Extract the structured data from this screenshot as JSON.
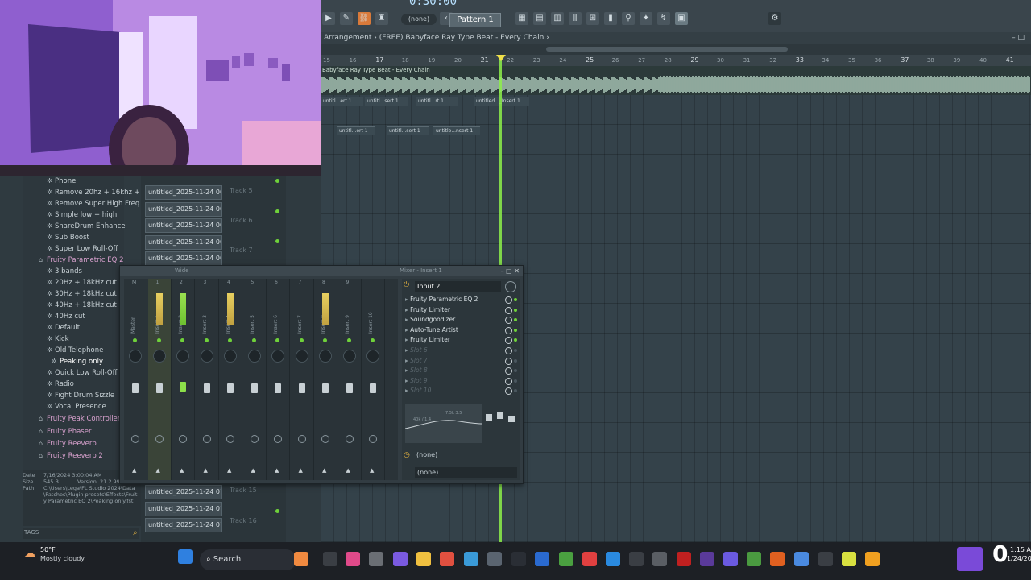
{
  "toolbar": {
    "time": "0:30:00",
    "none_selector": "(none)",
    "pattern": "Pattern 1"
  },
  "playlist": {
    "breadcrumb": "Arrangement › (FREE) Babyface Ray Type Beat - Every Chain ›",
    "audio_track_label": "Babyface Ray Type Beat - Every Chain",
    "timeline_ticks": [
      "15",
      "16",
      "17",
      "18",
      "19",
      "20",
      "21",
      "22",
      "23",
      "24",
      "25",
      "26",
      "27",
      "28",
      "29",
      "30",
      "31",
      "32",
      "33",
      "34",
      "35",
      "36",
      "37",
      "38",
      "39",
      "40",
      "41"
    ],
    "clips_row1": [
      "untitl...ert 1",
      "untitl...sert 1",
      "untitl...rt 1",
      "untitled..._Insert 1"
    ],
    "clips_row2": [
      "untitl...ert 1",
      "untitl...sert 1",
      "untitle...nsert 1"
    ]
  },
  "browser": {
    "items": [
      {
        "label": "Phone",
        "kind": "preset"
      },
      {
        "label": "Remove 20hz + 16khz +",
        "kind": "preset"
      },
      {
        "label": "Remove Super High Freq",
        "kind": "preset"
      },
      {
        "label": "Simple low + high",
        "kind": "preset"
      },
      {
        "label": "SnareDrum Enhance",
        "kind": "preset"
      },
      {
        "label": "Sub Boost",
        "kind": "preset"
      },
      {
        "label": "Super Low Roll-Off",
        "kind": "preset"
      },
      {
        "label": "Fruity Parametric EQ 2",
        "kind": "plugin"
      },
      {
        "label": "3 bands",
        "kind": "preset"
      },
      {
        "label": "20Hz + 18kHz cut",
        "kind": "preset"
      },
      {
        "label": "30Hz + 18kHz cut",
        "kind": "preset"
      },
      {
        "label": "40Hz + 18kHz cut",
        "kind": "preset"
      },
      {
        "label": "40Hz cut",
        "kind": "preset"
      },
      {
        "label": "Default",
        "kind": "preset"
      },
      {
        "label": "Kick",
        "kind": "preset"
      },
      {
        "label": "Old Telephone",
        "kind": "preset"
      },
      {
        "label": "Peaking only",
        "kind": "selected"
      },
      {
        "label": "Quick Low Roll-Off",
        "kind": "preset"
      },
      {
        "label": "Radio",
        "kind": "preset"
      },
      {
        "label": "Fight Drum Sizzle",
        "kind": "preset"
      },
      {
        "label": "Vocal Presence",
        "kind": "preset"
      },
      {
        "label": "Fruity Peak Controller",
        "kind": "plugin"
      },
      {
        "label": "Fruity Phaser",
        "kind": "plugin"
      },
      {
        "label": "Fruity Reeverb",
        "kind": "plugin"
      },
      {
        "label": "Fruity Reeverb 2",
        "kind": "plugin"
      }
    ],
    "info": {
      "date_label": "Date",
      "date": "7/16/2024 3:00:04 AM",
      "size_label": "Size",
      "size": "545 B",
      "version_label": "Version",
      "version": "21.2.99",
      "path_label": "Path",
      "path": "C:\\Users\\Lega\\FL Studio 2024\\Data\\Patches\\Plugin presets\\Effects\\Fruity Parametric EQ 2\\Peaking only.fst"
    },
    "tags_label": "TAGS"
  },
  "channels": {
    "top": [
      "untitled_2025-11-24 00-...",
      "untitled_2025-11-24 00-...",
      "untitled_2025-11-24 00-...",
      "untitled_2025-11-24 00-...",
      "untitled_2025-11-24 00-..."
    ],
    "bottom": [
      "untitled_2025-11-24 01-...",
      "untitled_2025-11-24 01-...",
      "untitled_2025-11-24 01-..."
    ],
    "tracks": [
      "Track 5",
      "Track 6",
      "Track 7",
      "Track 15",
      "Track 16"
    ]
  },
  "mixer": {
    "title": "Mixer - Insert 1",
    "wide_label": "Wide",
    "strips": [
      "Master",
      "Insert 1",
      "Insert 2",
      "Insert 3",
      "Insert 4",
      "Insert 5",
      "Insert 6",
      "Insert 7",
      "Insert 8",
      "Insert 9",
      "Insert 10"
    ],
    "strip_numbers": [
      "M",
      "1",
      "2",
      "3",
      "4",
      "5",
      "6",
      "7",
      "8",
      "9"
    ],
    "input": "Input 2",
    "fx_slots": [
      "Fruity Parametric EQ 2",
      "Fruity Limiter",
      "Soundgoodizer",
      "Auto-Tune Artist",
      "Fruity Limiter",
      "Slot 6",
      "Slot 7",
      "Slot 8",
      "Slot 9",
      "Slot 10"
    ],
    "eq_label_left": "40k / 1.4",
    "eq_label_right": "7.5k 3.5",
    "send_a": "(none)",
    "send_b": "(none)"
  },
  "taskbar": {
    "weather_temp": "50°F",
    "weather_desc": "Mostly cloudy",
    "search": "Search",
    "clock_time": "1:15 A",
    "clock_date": "1/24/202",
    "badge": "0"
  }
}
